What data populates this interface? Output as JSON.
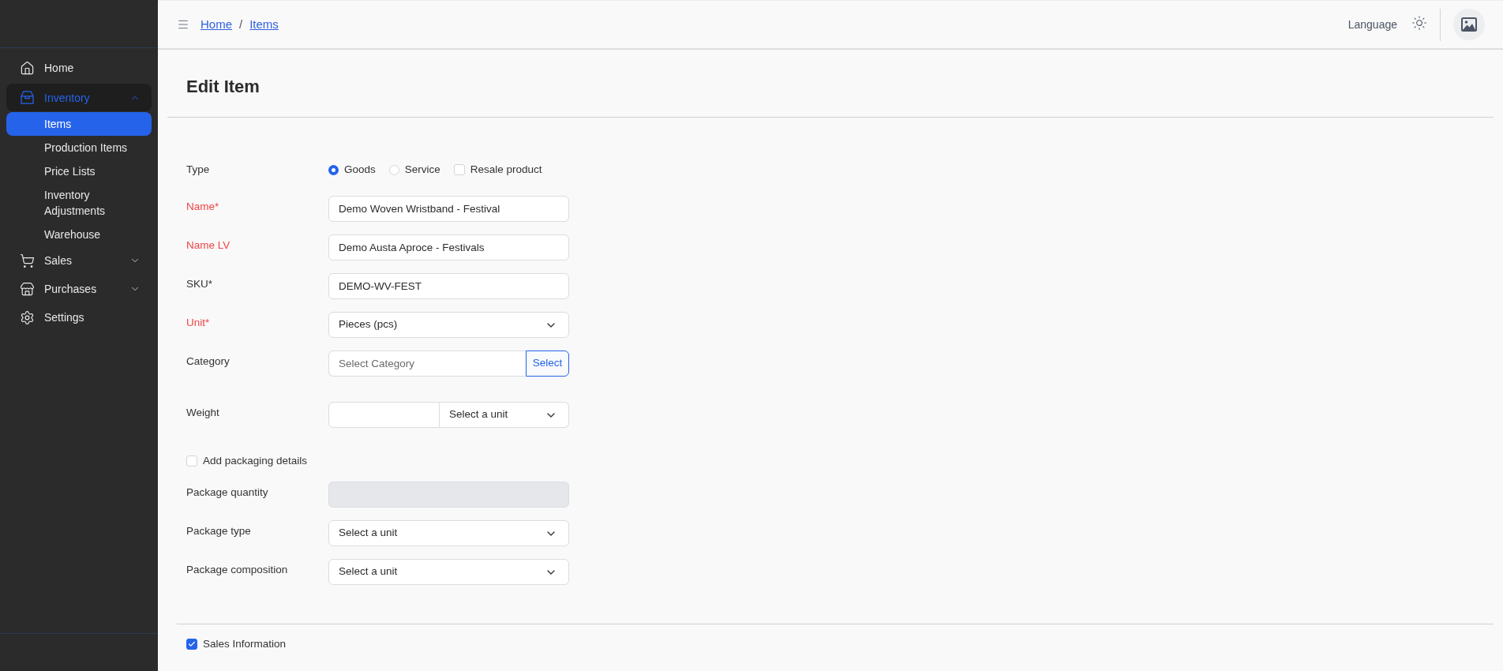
{
  "sidebar": {
    "items": [
      {
        "kind": "link",
        "label": "Home",
        "selected": false
      },
      {
        "kind": "group",
        "label": "Inventory",
        "selected": true,
        "expanded": true,
        "children": [
          {
            "label": "Items",
            "selected": true
          },
          {
            "label": "Production Items",
            "selected": false
          },
          {
            "label": "Price Lists",
            "selected": false
          },
          {
            "label": "Inventory Adjustments",
            "selected": false
          },
          {
            "label": "Warehouse",
            "selected": false
          }
        ]
      },
      {
        "kind": "group",
        "label": "Sales",
        "selected": false,
        "expanded": false
      },
      {
        "kind": "group",
        "label": "Purchases",
        "selected": false,
        "expanded": false
      },
      {
        "kind": "link",
        "label": "Settings",
        "selected": false
      }
    ]
  },
  "header": {
    "breadcrumbs": [
      {
        "label": "Home"
      },
      {
        "label": "Items"
      }
    ],
    "separator": "/",
    "language": "Language"
  },
  "page": {
    "title": "Edit Item"
  },
  "form": {
    "groups": [
      {
        "fields": [
          {
            "kind": "choice",
            "label": "Type",
            "invalid": false,
            "options": [
              {
                "kind": "radio",
                "label": "Goods",
                "selected": true
              },
              {
                "kind": "radio",
                "label": "Service",
                "selected": false
              },
              {
                "kind": "checkbox",
                "label": "Resale product",
                "checked": false
              }
            ]
          },
          {
            "kind": "text",
            "label": "Name*",
            "invalid": true,
            "disabled": false,
            "value": "Demo Woven Wristband - Festival"
          },
          {
            "kind": "text",
            "label": "Name LV",
            "invalid": true,
            "disabled": false,
            "value": "Demo Austa Aproce - Festivals"
          },
          {
            "kind": "text",
            "label": "SKU*",
            "invalid": false,
            "disabled": false,
            "value": "DEMO-WV-FEST"
          },
          {
            "kind": "select",
            "label": "Unit*",
            "invalid": true,
            "value": "Pieces (pcs)"
          },
          {
            "kind": "picker",
            "label": "Category",
            "invalid": false,
            "placeholder": "Select Category",
            "button": "Select"
          }
        ]
      },
      {
        "fields": [
          {
            "kind": "measure",
            "label": "Weight",
            "invalid": false,
            "unit": "Select a unit"
          }
        ]
      },
      {
        "fields": [
          {
            "kind": "checkbox",
            "label": "Add packaging details",
            "invalid": false,
            "checked": false
          },
          {
            "kind": "text",
            "label": "Package quantity",
            "invalid": false,
            "disabled": true
          },
          {
            "kind": "select",
            "label": "Package type",
            "invalid": false,
            "value": "Select a unit"
          },
          {
            "kind": "select",
            "label": "Package composition",
            "invalid": false,
            "value": "Select a unit"
          }
        ]
      }
    ]
  },
  "sales_section": {
    "label": "Sales Information",
    "checked": true
  }
}
